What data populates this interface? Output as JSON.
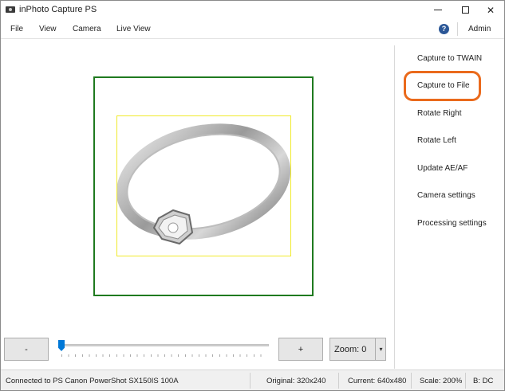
{
  "window": {
    "title": "inPhoto Capture PS",
    "minimize_glyph": "—",
    "maximize_glyph": "☐",
    "close_glyph": "✕"
  },
  "menu": {
    "items": [
      "File",
      "View",
      "Camera",
      "Live View"
    ],
    "help_glyph": "?",
    "admin_label": "Admin"
  },
  "actions": [
    "Capture to TWAIN",
    "Capture to File",
    "Rotate Right",
    "Rotate Left",
    "Update AE/AF",
    "Camera settings",
    "Processing settings"
  ],
  "highlighted_action": "Capture to File",
  "colors": {
    "highlight": "#ea6a1c",
    "preview_frame": "#1f7a1f",
    "crop_box": "#f0ea2a",
    "slider_thumb": "#0078d7"
  },
  "zoom": {
    "minus_label": "-",
    "plus_label": "+",
    "slider_value_fraction": 0.0,
    "zoom_label": "Zoom: 0",
    "dropdown_glyph": "▾"
  },
  "status": {
    "connection": "Connected to PS Canon PowerShot SX150IS 100A",
    "original": "Original: 320x240",
    "current": "Current: 640x480",
    "scale": "Scale: 200%",
    "mode": "B: DC"
  }
}
